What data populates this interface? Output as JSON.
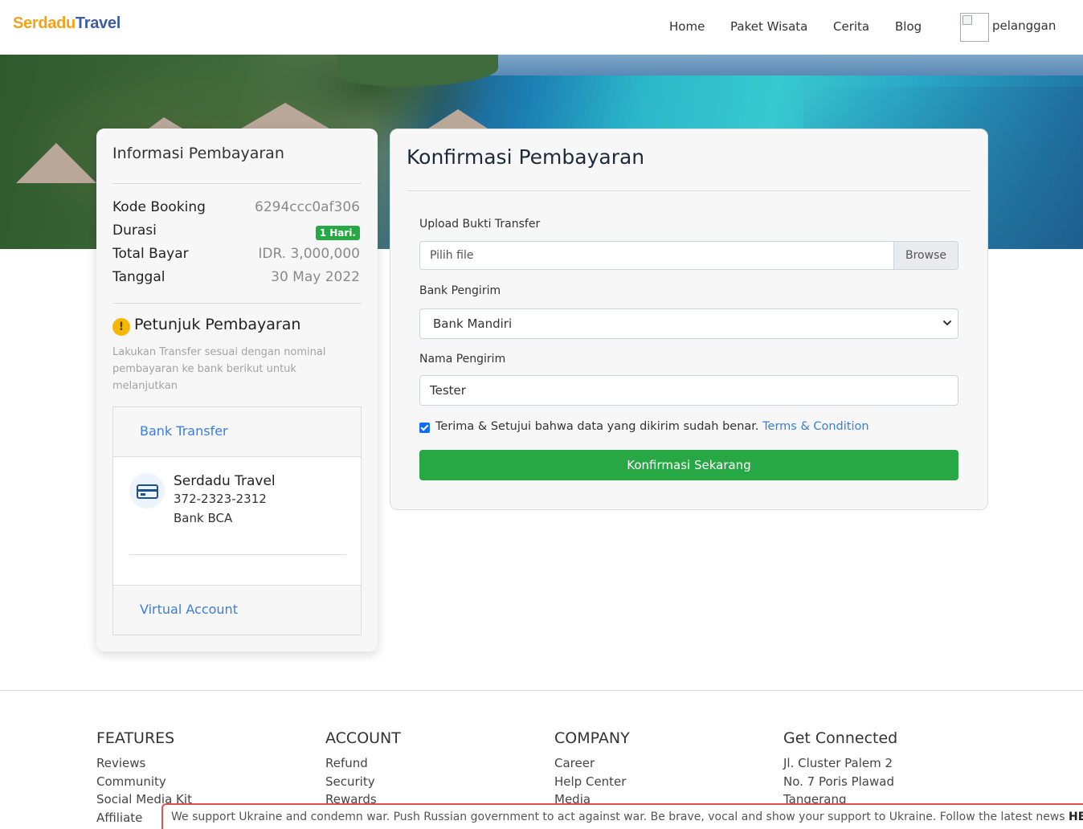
{
  "brand": {
    "part1": "Serdadu",
    "part2": "Travel"
  },
  "nav": {
    "items": [
      {
        "label": "Home"
      },
      {
        "label": "Paket Wisata"
      },
      {
        "label": "Cerita"
      },
      {
        "label": "Blog"
      }
    ],
    "user": "pelanggan"
  },
  "payment_info": {
    "title": "Informasi Pembayaran",
    "rows": [
      {
        "label": "Kode Booking",
        "value": "6294ccc0af306"
      },
      {
        "label": "Durasi",
        "value": "1 Hari."
      },
      {
        "label": "Total Bayar",
        "value": "IDR. 3,000,000"
      },
      {
        "label": "Tanggal",
        "value": "30 May 2022"
      }
    ],
    "instructions_title": "Petunjuk Pembayaran",
    "instructions_icon": "!",
    "instructions_text": "Lakukan Transfer sesuai dengan nominal pembayaran ke bank berikut untuk melanjutkan",
    "methods": [
      {
        "label": "Bank Transfer"
      },
      {
        "label": "Virtual Account"
      }
    ],
    "bank": {
      "name": "Serdadu Travel",
      "account": "372-2323-2312",
      "bank_name": "Bank BCA"
    }
  },
  "confirm_form": {
    "title": "Konfirmasi Pembayaran",
    "upload_label": "Upload Bukti Transfer",
    "upload_placeholder": "Pilih file",
    "browse_label": "Browse",
    "bank_label": "Bank Pengirim",
    "bank_selected": "Bank Mandiri",
    "name_label": "Nama Pengirim",
    "name_value": "Tester",
    "agree_text": "Terima & Setujui bahwa data yang dikirim sudah benar.",
    "agree_checked": true,
    "terms_link": "Terms & Condition",
    "submit_label": "Konfirmasi Sekarang"
  },
  "footer": {
    "columns": [
      {
        "title": "FEATURES",
        "items": [
          "Reviews",
          "Community",
          "Social Media Kit",
          "Affiliate"
        ]
      },
      {
        "title": "ACCOUNT",
        "items": [
          "Refund",
          "Security",
          "Rewards"
        ]
      },
      {
        "title": "COMPANY",
        "items": [
          "Career",
          "Help Center",
          "Media"
        ]
      },
      {
        "title": "Get Connected",
        "items": [
          "Jl. Cluster Palem 2",
          "No. 7 Poris Plawad",
          "Tangerang"
        ]
      }
    ]
  },
  "banner": {
    "text": "We support Ukraine and condemn war. Push Russian government to act against war. Be brave, vocal and show your support to Ukraine. Follow the latest news",
    "link": "HERE"
  },
  "colors": {
    "accent_green": "#28a745",
    "link_blue": "#3b7ddd",
    "brand_orange": "#f0a318",
    "brand_blue": "#3b5ca8",
    "banner_border": "#e05050"
  }
}
